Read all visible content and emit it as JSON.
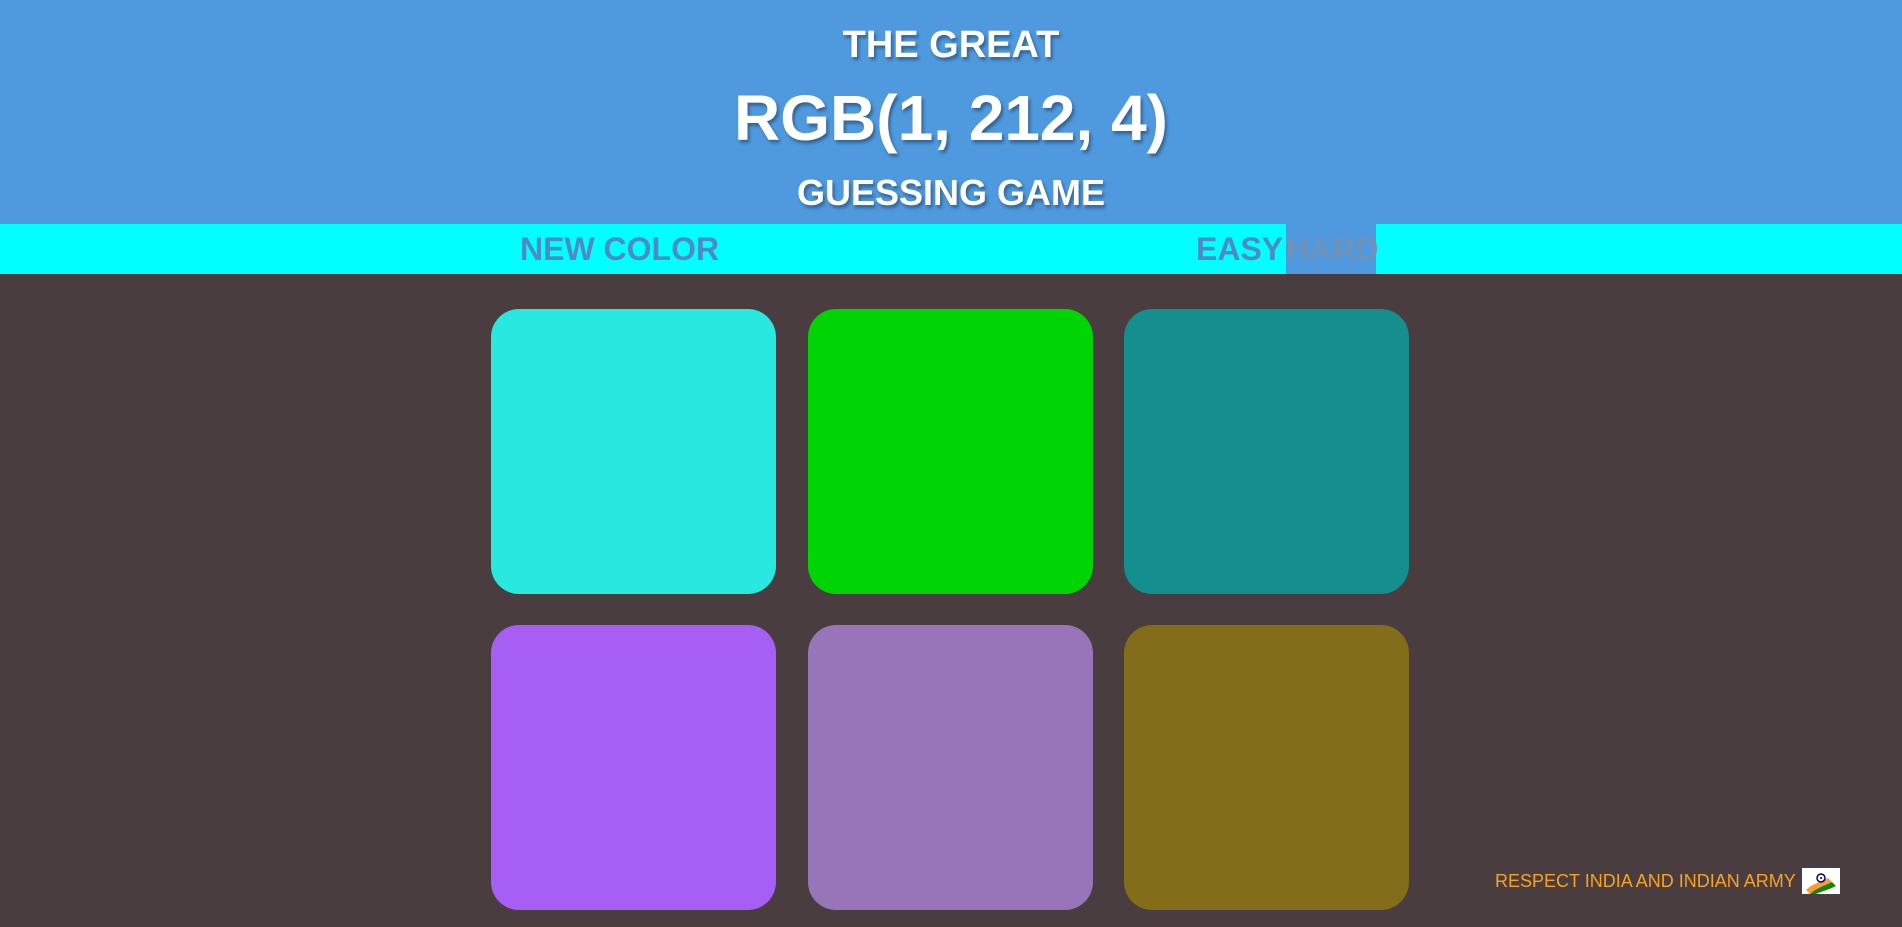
{
  "header": {
    "title_top": "THE GREAT",
    "rgb_display": "RGB(1, 212, 4)",
    "title_bottom": "GUESSING GAME",
    "background": "#4f99de"
  },
  "toolbar": {
    "new_color_label": "NEW COLOR",
    "easy_label": "EASY",
    "hard_label": "HARD",
    "selected_mode": "HARD",
    "background": "#00ffff"
  },
  "squares": [
    {
      "color": "#28e8e0"
    },
    {
      "color": "#01d404"
    },
    {
      "color": "#148f8e"
    },
    {
      "color": "#a75ef5"
    },
    {
      "color": "#9874b9"
    },
    {
      "color": "#826d1a"
    }
  ],
  "footer": {
    "text": "RESPECT INDIA AND INDIAN ARMY",
    "text_color": "#f9a21f",
    "flag_icon": "india-flag-icon"
  },
  "colors": {
    "page_background": "#4a3d3f"
  }
}
